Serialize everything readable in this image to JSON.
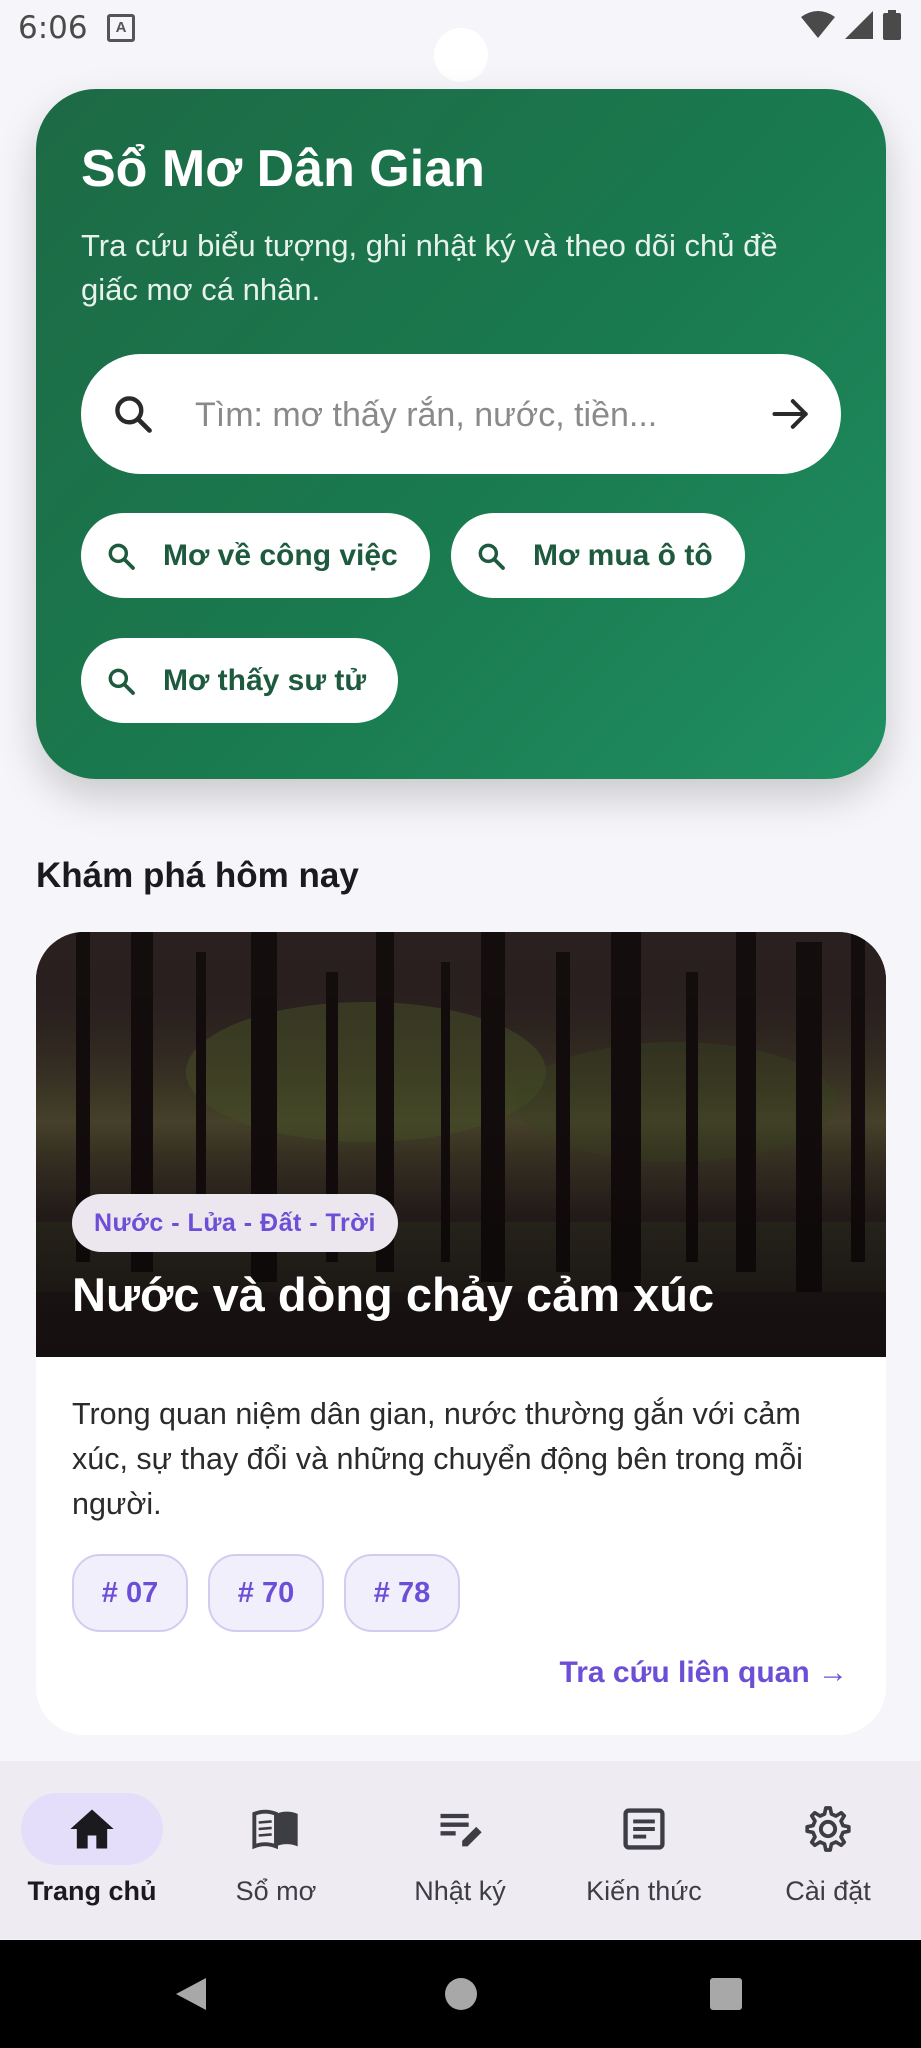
{
  "status_bar": {
    "time": "6:06",
    "notification_icon": "A"
  },
  "hero": {
    "title": "Sổ Mơ Dân Gian",
    "subtitle": "Tra cứu biểu tượng, ghi nhật ký và theo dõi chủ đề giấc mơ cá nhân.",
    "search": {
      "placeholder": "Tìm: mơ thấy rắn, nước, tiền...",
      "value": ""
    },
    "suggestions": [
      "Mơ về công việc",
      "Mơ mua ô tô",
      "Mơ thấy sư tử"
    ]
  },
  "discover": {
    "heading": "Khám phá hôm nay",
    "card": {
      "tag": "Nước - Lửa - Đất - Trời",
      "title": "Nước và dòng chảy cảm xúc",
      "description": "Trong quan niệm dân gian, nước thường gắn với cảm xúc, sự thay đổi và những chuyển động bên trong mỗi người.",
      "numbers": [
        "# 07",
        "# 70",
        "# 78"
      ],
      "link": "Tra cứu liên quan →"
    }
  },
  "bottom_nav": {
    "items": [
      {
        "label": "Trang chủ",
        "icon": "home-icon",
        "active": true
      },
      {
        "label": "Sổ mơ",
        "icon": "book-icon",
        "active": false
      },
      {
        "label": "Nhật ký",
        "icon": "journal-edit-icon",
        "active": false
      },
      {
        "label": "Kiến thức",
        "icon": "article-icon",
        "active": false
      },
      {
        "label": "Cài đặt",
        "icon": "gear-icon",
        "active": false
      }
    ]
  },
  "colors": {
    "primary_green": "#1a7a4f",
    "accent_purple": "#6c4fd6",
    "active_pill": "#e5defa"
  }
}
